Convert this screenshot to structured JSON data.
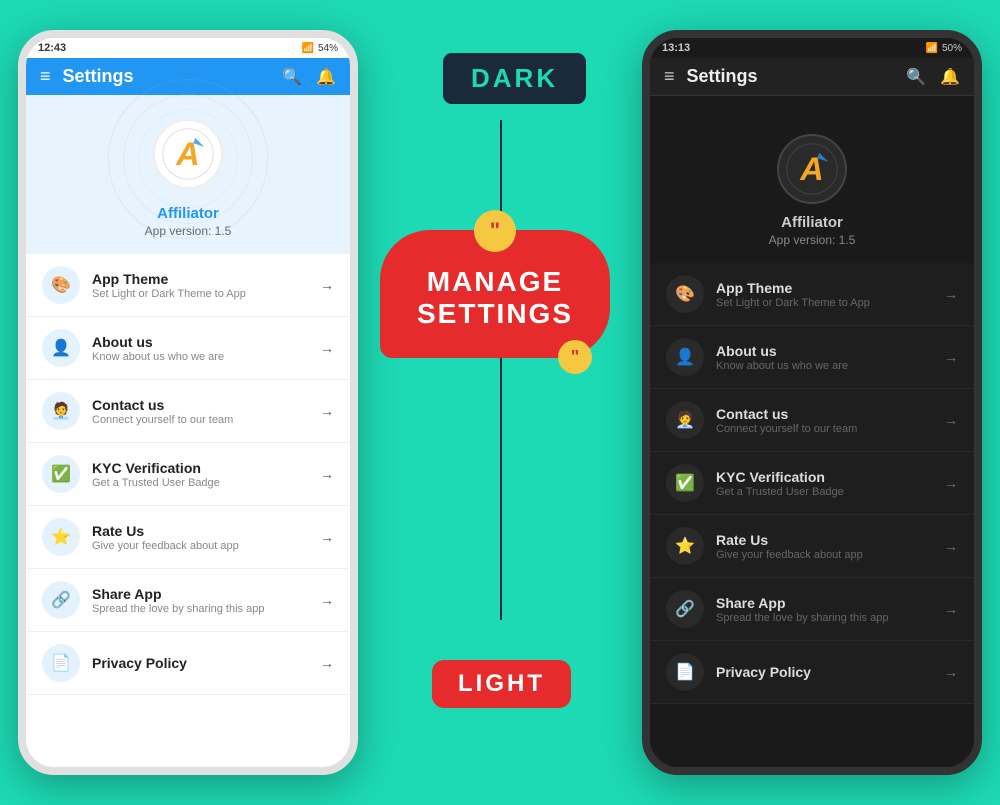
{
  "background": "#1dd9b4",
  "center": {
    "dark_label": "DARK",
    "light_label": "LIGHT",
    "manage_text_line1": "MANAGE",
    "manage_text_line2": "SETTINGS"
  },
  "light_phone": {
    "status_time": "12:43",
    "status_battery": "54%",
    "header_title": "Settings",
    "app_name": "Affiliator",
    "app_version": "App version: 1.5",
    "items": [
      {
        "icon": "🎨",
        "title": "App Theme",
        "subtitle": "Set Light or Dark Theme to App"
      },
      {
        "icon": "👤",
        "title": "About us",
        "subtitle": "Know about us who we are"
      },
      {
        "icon": "🧑‍💼",
        "title": "Contact us",
        "subtitle": "Connect yourself to our team"
      },
      {
        "icon": "✅",
        "title": "KYC Verification",
        "subtitle": "Get a Trusted User Badge"
      },
      {
        "icon": "⭐",
        "title": "Rate Us",
        "subtitle": "Give your feedback about app"
      },
      {
        "icon": "↗",
        "title": "Share App",
        "subtitle": "Spread the love by sharing this app"
      },
      {
        "icon": "📄",
        "title": "Privacy Policy",
        "subtitle": ""
      }
    ]
  },
  "dark_phone": {
    "status_time": "13:13",
    "status_battery": "50%",
    "header_title": "Settings",
    "app_name": "Affiliator",
    "app_version": "App version: 1.5",
    "items": [
      {
        "icon": "🎨",
        "title": "App Theme",
        "subtitle": "Set Light or Dark Theme to App"
      },
      {
        "icon": "👤",
        "title": "About us",
        "subtitle": "Know about us who we are"
      },
      {
        "icon": "🧑‍💼",
        "title": "Contact us",
        "subtitle": "Connect yourself to our team"
      },
      {
        "icon": "✅",
        "title": "KYC Verification",
        "subtitle": "Get a Trusted User Badge"
      },
      {
        "icon": "⭐",
        "title": "Rate Us",
        "subtitle": "Give your feedback about app"
      },
      {
        "icon": "↗",
        "title": "Share App",
        "subtitle": "Spread the love by sharing this app"
      },
      {
        "icon": "📄",
        "title": "Privacy Policy",
        "subtitle": ""
      }
    ]
  }
}
